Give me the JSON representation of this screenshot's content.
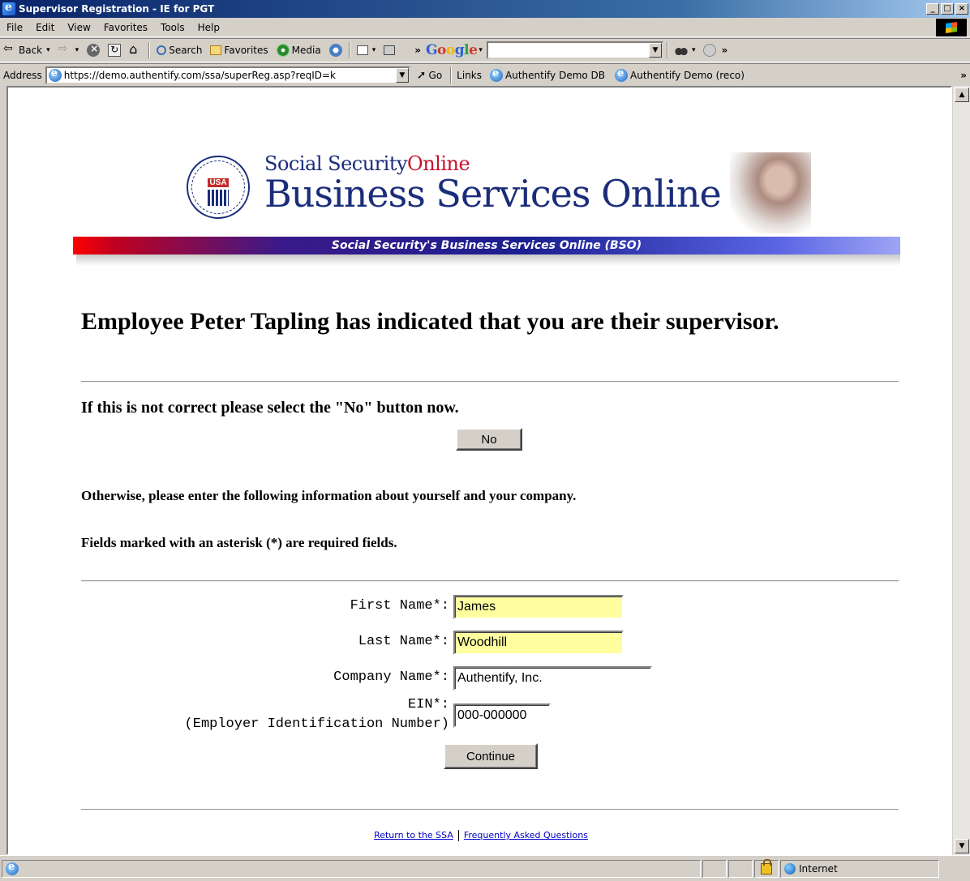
{
  "window": {
    "title": "Supervisor Registration - IE for PGT",
    "controls": [
      "_",
      "□",
      "×"
    ]
  },
  "menu": [
    "File",
    "Edit",
    "View",
    "Favorites",
    "Tools",
    "Help"
  ],
  "toolbar": {
    "back_label": "Back",
    "search_label": "Search",
    "favorites_label": "Favorites",
    "media_label": "Media",
    "chevron": "»",
    "google_input": ""
  },
  "address": {
    "label": "Address",
    "url": "https://demo.authentify.com/ssa/superReg.asp?reqID=k",
    "go_label": "Go",
    "links_label": "Links",
    "links": [
      "Authentify Demo DB",
      "Authentify Demo (reco)"
    ]
  },
  "banner": {
    "seal_text": "USA",
    "ssa_brand_1": "Social Security",
    "ssa_brand_2": "Online",
    "bso_title": "Business Services Online",
    "strip_text": "Social Security's Business Services Online (BSO)"
  },
  "main": {
    "headline": "Employee Peter Tapling has indicated that you are their supervisor.",
    "notice": "If this is not correct please select the \"No\" button now.",
    "no_button": "No",
    "otherwise": "Otherwise, please enter the following information about yourself and your company.",
    "required_note": "Fields marked with an asterisk (*) are required fields."
  },
  "form": {
    "first_name_label": "First Name*:",
    "first_name_value": "James",
    "last_name_label": "Last Name*:",
    "last_name_value": "Woodhill",
    "company_label": "Company Name*:",
    "company_value": "Authentify, Inc.",
    "ein_label": "EIN*:",
    "ein_sublabel": "(Employer Identification Number)",
    "ein_value": "000-000000",
    "continue_button": "Continue"
  },
  "footer": {
    "link1": "Return to the SSA",
    "link2": "Frequently Asked Questions"
  },
  "status": {
    "zone": "Internet"
  }
}
